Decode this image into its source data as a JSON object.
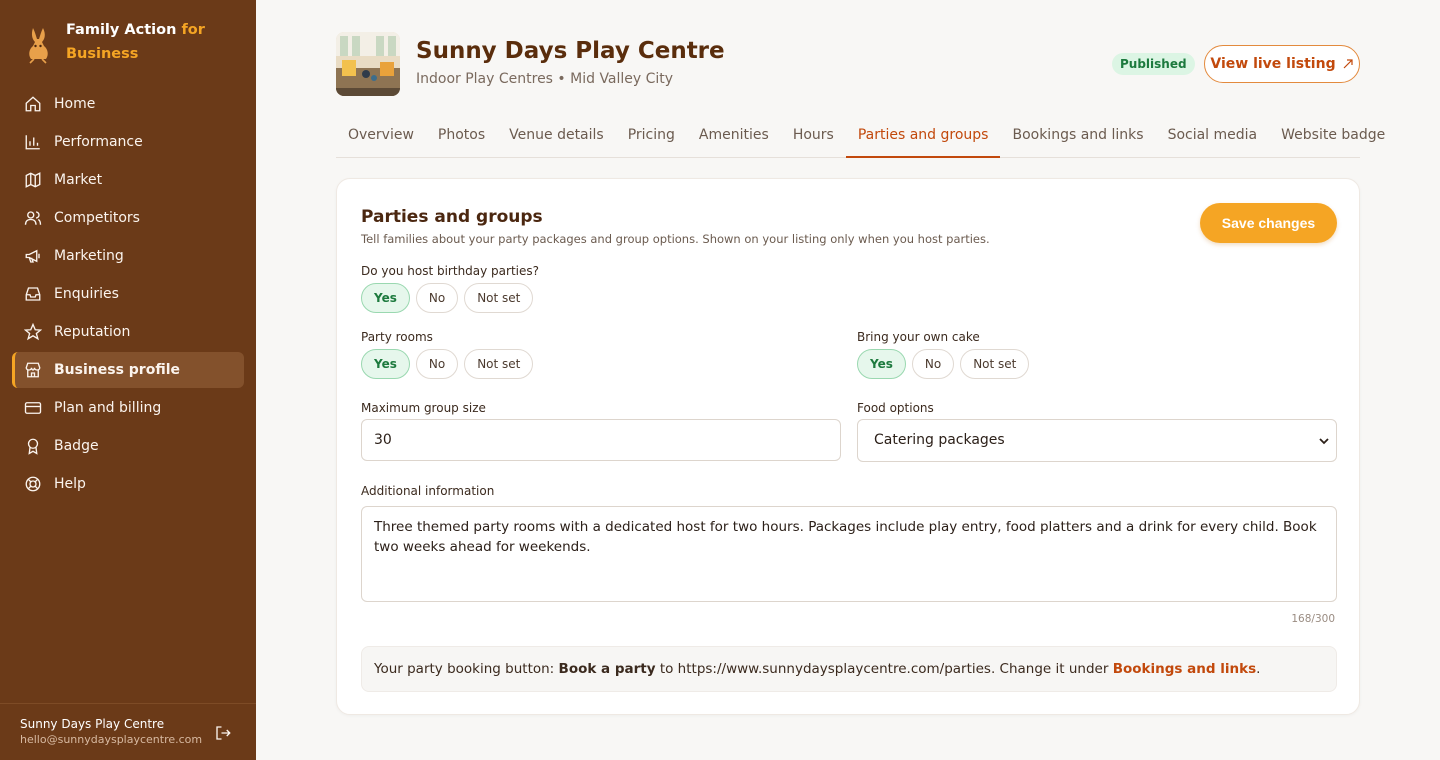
{
  "brand": {
    "name_part1": "Family Action ",
    "name_accent": "for",
    "name_part2": "Business",
    "logo_icon": "rabbit-icon"
  },
  "nav": [
    {
      "label": "Home",
      "icon": "home-icon"
    },
    {
      "label": "Performance",
      "icon": "bar-chart-icon"
    },
    {
      "label": "Market",
      "icon": "map-icon"
    },
    {
      "label": "Competitors",
      "icon": "users-icon"
    },
    {
      "label": "Marketing",
      "icon": "megaphone-icon"
    },
    {
      "label": "Enquiries",
      "icon": "inbox-icon"
    },
    {
      "label": "Reputation",
      "icon": "star-icon"
    },
    {
      "label": "Business profile",
      "icon": "store-icon",
      "active": true
    },
    {
      "label": "Plan and billing",
      "icon": "credit-card-icon"
    },
    {
      "label": "Badge",
      "icon": "award-icon"
    },
    {
      "label": "Help",
      "icon": "lifebuoy-icon"
    }
  ],
  "account": {
    "name": "Sunny Days Play Centre",
    "email": "hello@sunnydaysplaycentre.com"
  },
  "header": {
    "title": "Sunny Days Play Centre",
    "subtitle": "Indoor Play Centres • Mid Valley City",
    "status": "Published",
    "view_live": "View live listing"
  },
  "tabs": [
    "Overview",
    "Photos",
    "Venue details",
    "Pricing",
    "Amenities",
    "Hours",
    "Parties and groups",
    "Bookings and links",
    "Social media",
    "Website badge"
  ],
  "active_tab": "Parties and groups",
  "form": {
    "title": "Parties and groups",
    "description": "Tell families about your party packages and group options. Shown on your listing only when you host parties.",
    "save_label": "Save changes",
    "options": [
      "Yes",
      "No",
      "Not set"
    ],
    "birthday": {
      "label": "Do you host birthday parties?",
      "value": "Yes"
    },
    "party_rooms": {
      "label": "Party rooms",
      "value": "Yes"
    },
    "own_cake": {
      "label": "Bring your own cake",
      "value": "Yes"
    },
    "group_size": {
      "label": "Maximum group size",
      "value": "30"
    },
    "food": {
      "label": "Food options",
      "value": "Catering packages"
    },
    "additional": {
      "label": "Additional information",
      "value": "Three themed party rooms with a dedicated host for two hours. Packages include play entry, food platters and a drink for every child. Book two weeks ahead for weekends.",
      "counter": "168/300"
    },
    "info": {
      "prefix": "Your party booking button: ",
      "button_name": "Book a party",
      "middle": " to https://www.sunnydaysplaycentre.com/parties. Change it under ",
      "link": "Bookings and links",
      "suffix": "."
    }
  },
  "colors": {
    "sidebar": "#6b3a18",
    "accent": "#f5a524",
    "link": "#c2490c",
    "success": "#1d7a3e"
  }
}
